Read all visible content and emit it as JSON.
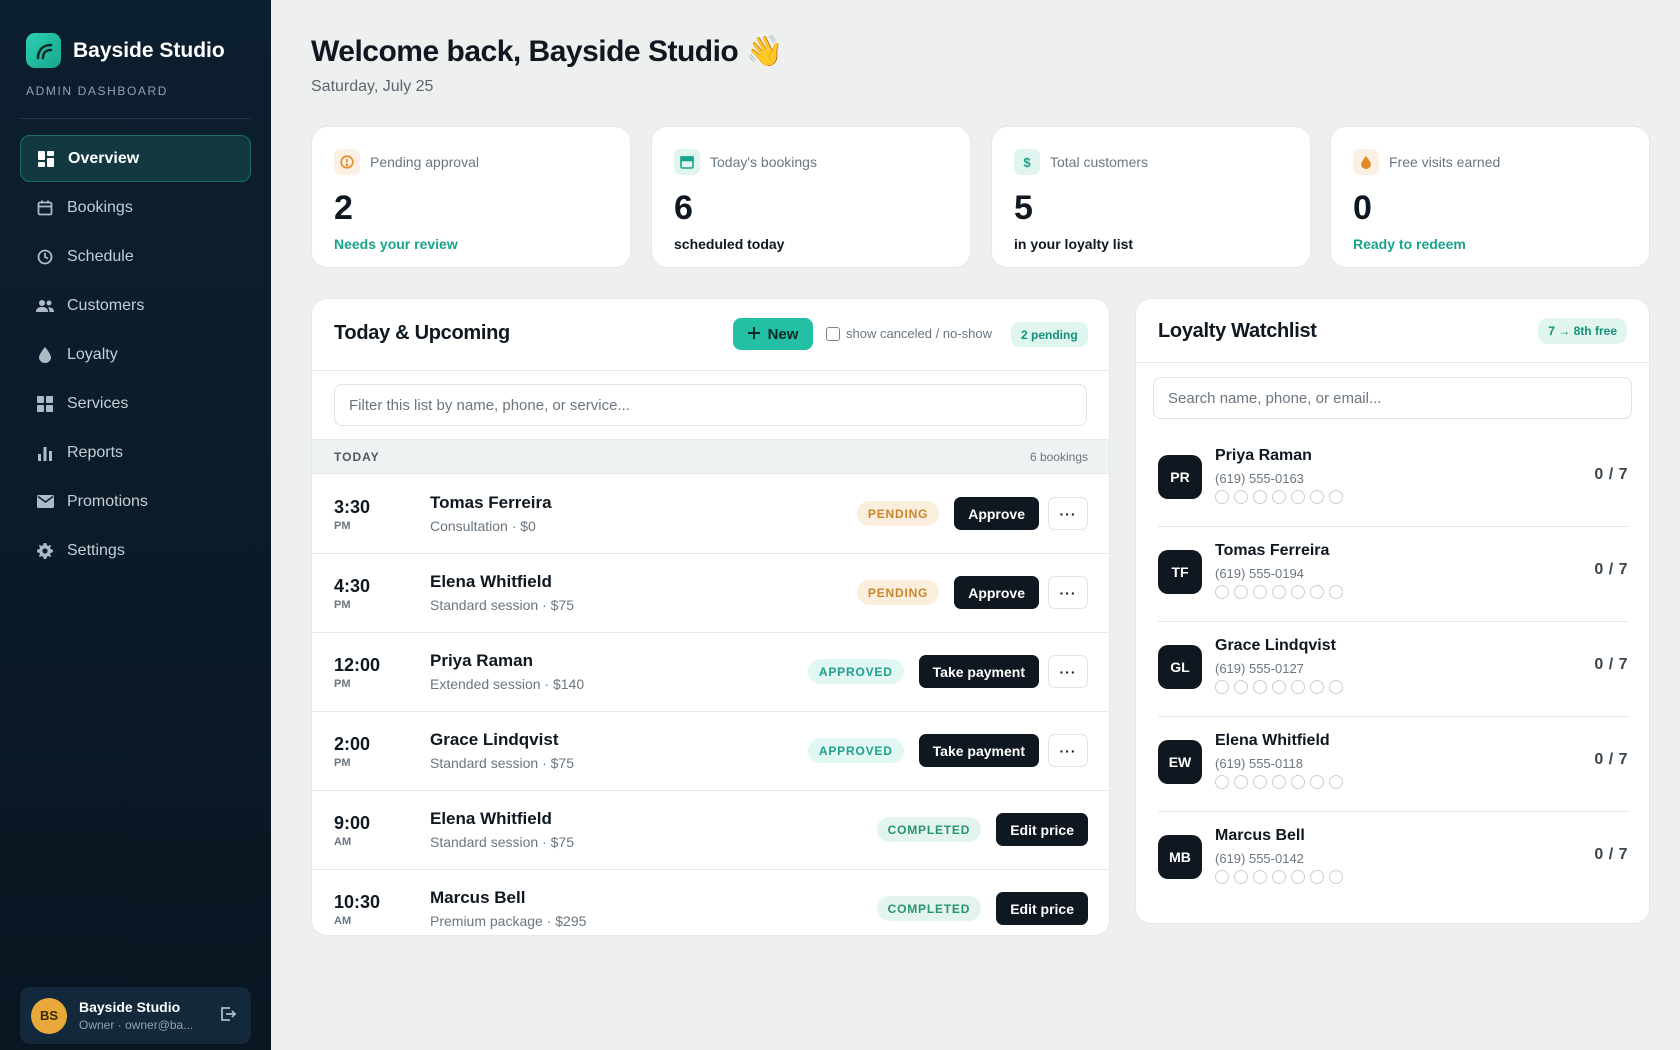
{
  "sidebar": {
    "brand": "Bayside Studio",
    "subtitle": "ADMIN DASHBOARD",
    "items": [
      {
        "label": "Overview",
        "icon": "grid-icon",
        "active": true
      },
      {
        "label": "Bookings",
        "icon": "calendar-icon"
      },
      {
        "label": "Schedule",
        "icon": "clock-icon"
      },
      {
        "label": "Customers",
        "icon": "people-icon"
      },
      {
        "label": "Loyalty",
        "icon": "drop-icon"
      },
      {
        "label": "Services",
        "icon": "apps-icon"
      },
      {
        "label": "Reports",
        "icon": "bar-chart-icon"
      },
      {
        "label": "Promotions",
        "icon": "mail-icon"
      },
      {
        "label": "Settings",
        "icon": "gear-icon"
      }
    ],
    "user": {
      "initials": "BS",
      "name": "Bayside Studio",
      "sub": "Owner · owner@ba..."
    }
  },
  "header": {
    "welcome": "Welcome back, Bayside Studio 👋",
    "date": "Saturday, July 25"
  },
  "stats": [
    {
      "label": "Pending approval",
      "value": "2",
      "foot": "Needs your review",
      "icon": "alert-icon",
      "accent": "#e08a2a"
    },
    {
      "label": "Today's bookings",
      "value": "6",
      "foot": "scheduled today",
      "icon": "calendar-icon",
      "accent": "#1aa38c"
    },
    {
      "label": "Total customers",
      "value": "5",
      "foot": "in your loyalty list",
      "icon": "dollar-icon",
      "accent": "#1aa38c"
    },
    {
      "label": "Free visits earned",
      "value": "0",
      "foot": "Ready to redeem",
      "icon": "drop-icon",
      "accent": "#e08a2a"
    }
  ],
  "bookings": {
    "title": "Today & Upcoming",
    "new_label": "New",
    "show_canceled_label": "show canceled / no-show",
    "pending_pill": "2 pending",
    "filter_placeholder": "Filter this list by name, phone, or service...",
    "section_label": "TODAY",
    "section_count": "6 bookings",
    "more_label": "···",
    "rows": [
      {
        "time": "3:30",
        "ampm": "PM",
        "name": "Tomas Ferreira",
        "service": "Consultation · $0",
        "status": "PENDING",
        "action": "Approve"
      },
      {
        "time": "4:30",
        "ampm": "PM",
        "name": "Elena Whitfield",
        "service": "Standard session · $75",
        "status": "PENDING",
        "action": "Approve"
      },
      {
        "time": "12:00",
        "ampm": "PM",
        "name": "Priya Raman",
        "service": "Extended session · $140",
        "status": "APPROVED",
        "action": "Take payment"
      },
      {
        "time": "2:00",
        "ampm": "PM",
        "name": "Grace Lindqvist",
        "service": "Standard session · $75",
        "status": "APPROVED",
        "action": "Take payment"
      },
      {
        "time": "9:00",
        "ampm": "AM",
        "name": "Elena Whitfield",
        "service": "Standard session · $75",
        "status": "COMPLETED",
        "action": "Edit price"
      },
      {
        "time": "10:30",
        "ampm": "AM",
        "name": "Marcus Bell",
        "service": "Premium package · $295",
        "status": "COMPLETED",
        "action": "Edit price"
      }
    ]
  },
  "loyalty": {
    "title": "Loyalty Watchlist",
    "pill": "7 → 8th free",
    "search_placeholder": "Search name, phone, or email...",
    "rows": [
      {
        "initials": "PR",
        "name": "Priya Raman",
        "phone": "(619) 555-0163",
        "score": "0 / 7",
        "visits": 0
      },
      {
        "initials": "TF",
        "name": "Tomas Ferreira",
        "phone": "(619) 555-0194",
        "score": "0 / 7",
        "visits": 0
      },
      {
        "initials": "GL",
        "name": "Grace Lindqvist",
        "phone": "(619) 555-0127",
        "score": "0 / 7",
        "visits": 0
      },
      {
        "initials": "EW",
        "name": "Elena Whitfield",
        "phone": "(619) 555-0118",
        "score": "0 / 7",
        "visits": 0
      },
      {
        "initials": "MB",
        "name": "Marcus Bell",
        "phone": "(619) 555-0142",
        "score": "0 / 7",
        "visits": 0
      }
    ]
  }
}
